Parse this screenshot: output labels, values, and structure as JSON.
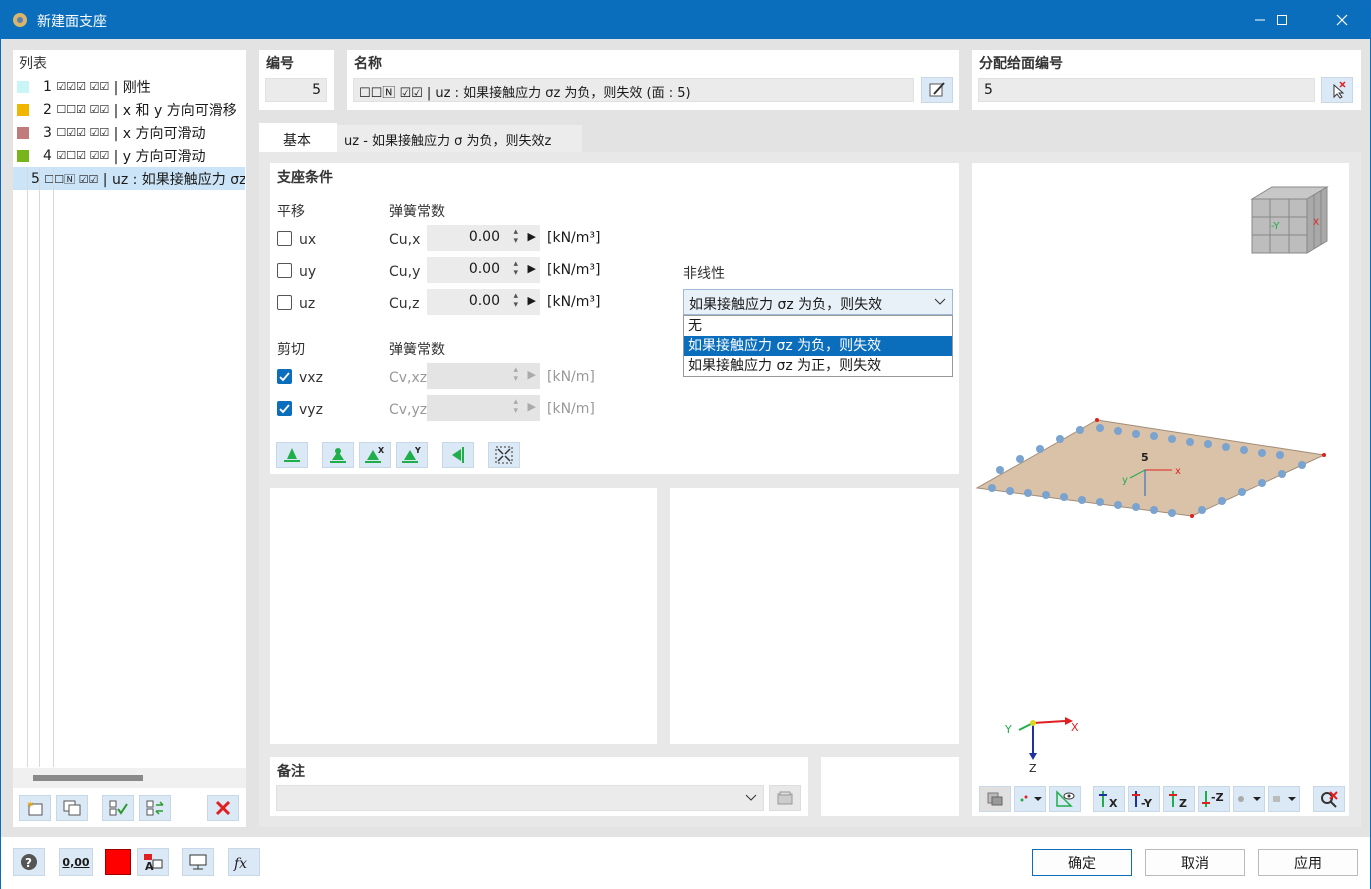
{
  "window": {
    "title": "新建面支座",
    "minimize_icon": "minimize-icon",
    "maximize_icon": "maximize-icon",
    "close_icon": "close-icon"
  },
  "list": {
    "header": "列表",
    "items": [
      {
        "num": "1",
        "flags": "☑☑☑ ☑☑",
        "label": "| 刚性",
        "color": "#c9f5f7"
      },
      {
        "num": "2",
        "flags": "☐☐☑ ☑☑",
        "label": "| x 和 y 方向可滑移",
        "color": "#f2b600"
      },
      {
        "num": "3",
        "flags": "☐☑☑ ☑☑",
        "label": "| x 方向可滑动",
        "color": "#c27b7b"
      },
      {
        "num": "4",
        "flags": "☑☐☑ ☑☑",
        "label": "| y 方向可滑动",
        "color": "#77b51a"
      },
      {
        "num": "5",
        "flags": "☐☐🄽 ☑☑",
        "label": "| uz : 如果接触应力 σz 为负，则失效",
        "color": "#b8204a"
      }
    ]
  },
  "number": {
    "label": "编号",
    "value": "5"
  },
  "name": {
    "label": "名称",
    "value": "☐☐🄽 ☑☑ | uz : 如果接触应力 σz 为负，则失效 (面 : 5)"
  },
  "assign": {
    "label": "分配给面编号",
    "value": "5"
  },
  "tabs": [
    {
      "label": "基本",
      "active": true
    },
    {
      "label": "uz - 如果接触应力 σ 为负，则失效z",
      "active": false
    }
  ],
  "support": {
    "section_title": "支座条件",
    "translation_label": "平移",
    "spring_label": "弹簧常数",
    "shear_label": "剪切",
    "shear_spring_label": "弹簧常数",
    "rows": [
      {
        "name": "ux",
        "spring": "Cu,x",
        "value": "0.00",
        "unit": "[kN/m³]",
        "checked": false
      },
      {
        "name": "uy",
        "spring": "Cu,y",
        "value": "0.00",
        "unit": "[kN/m³]",
        "checked": false
      },
      {
        "name": "uz",
        "spring": "Cu,z",
        "value": "0.00",
        "unit": "[kN/m³]",
        "checked": false
      }
    ],
    "shear_rows": [
      {
        "name": "vxz",
        "spring": "Cv,xz",
        "value": "",
        "unit": "[kN/m]",
        "checked": true
      },
      {
        "name": "vyz",
        "spring": "Cv,yz",
        "value": "",
        "unit": "[kN/m]",
        "checked": true
      }
    ]
  },
  "nonlinear": {
    "label": "非线性",
    "selected": "如果接触应力 σz 为负，则失效",
    "options": [
      "无",
      "如果接触应力 σz 为负，则失效",
      "如果接触应力 σz 为正，则失效"
    ]
  },
  "comment": {
    "label": "备注",
    "value": ""
  },
  "view": {
    "cube_front": "-Y",
    "cube_side": "X",
    "surface_label": "5",
    "axis_x": "X",
    "axis_y": "Y",
    "axis_z": "Z",
    "local_x": "x",
    "local_y": "y",
    "buttons": [
      "X",
      "-Y",
      "Z",
      "-Z"
    ]
  },
  "footer": {
    "ok": "确定",
    "cancel": "取消",
    "apply": "应用",
    "units_icon_label": "0,00"
  }
}
